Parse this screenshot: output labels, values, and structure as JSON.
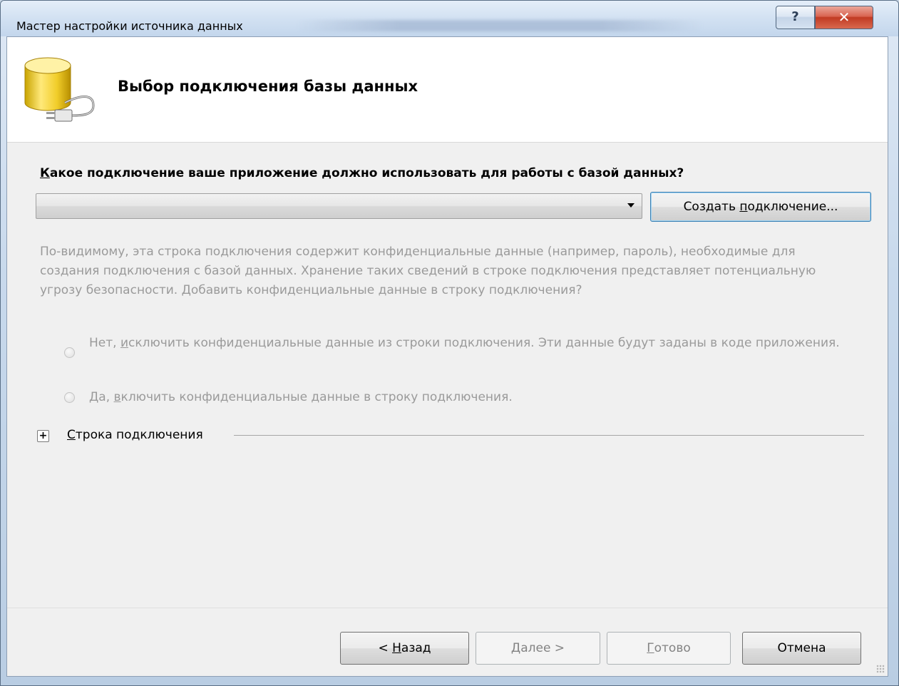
{
  "window": {
    "title": "Мастер настройки источника данных",
    "help_glyph": "?",
    "close_glyph": "✕"
  },
  "header": {
    "title": "Выбор подключения базы данных"
  },
  "question": {
    "accel": "К",
    "rest": "акое подключение ваше приложение должно использовать для работы с базой данных?"
  },
  "connection_combo": {
    "value": ""
  },
  "create_button": {
    "pre": "Создать ",
    "accel": "п",
    "post": "одключение..."
  },
  "info": {
    "text": "По-видимому, эта строка подключения содержит конфиденциальные данные (например, пароль), необходимые для создания подключения с базой данных. Хранение таких сведений в строке подключения представляет потенциальную угрозу безопасности. Добавить конфиденциальные данные в строку подключения?"
  },
  "options": {
    "exclude": {
      "pre": "Нет, ",
      "accel": "и",
      "post": "сключить конфиденциальные данные из строки подключения. Эти данные будут заданы в коде приложения."
    },
    "include": {
      "pre": "Да, ",
      "accel": "в",
      "post": "ключить конфиденциальные данные в строку подключения."
    }
  },
  "connection_string": {
    "expander_glyph": "+",
    "accel": "С",
    "rest": "трока подключения"
  },
  "footer": {
    "back": {
      "pre": "< ",
      "accel": "Н",
      "post": "азад"
    },
    "next": {
      "accel": "Д",
      "post": "алее >"
    },
    "finish": {
      "accel": "Г",
      "post": "отово"
    },
    "cancel": "Отмена"
  }
}
